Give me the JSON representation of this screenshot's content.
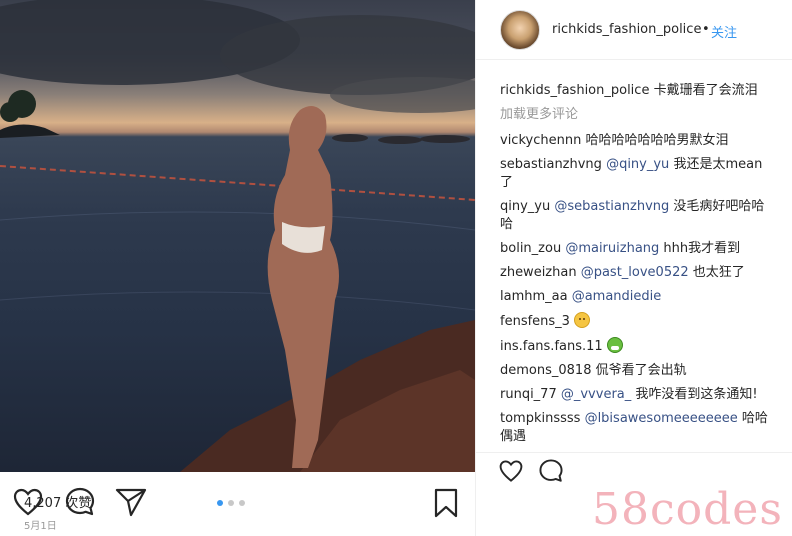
{
  "post": {
    "image_alt": "",
    "carousel": {
      "count": 3,
      "active": 0
    }
  },
  "header": {
    "username": "richkids_fashion_police",
    "separator": "•",
    "follow_label": "关注"
  },
  "caption": {
    "user": "richkids_fashion_police",
    "text": " 卡戴珊看了会流泪"
  },
  "load_more_label": "加载更多评论",
  "comments": [
    {
      "user": "vickychennn",
      "mention": "",
      "text": " 哈哈哈哈哈哈哈男默女泪"
    },
    {
      "user": "sebastianzhvng",
      "mention": " @qiny_yu",
      "text": " 我还是太mean了"
    },
    {
      "user": "qiny_yu",
      "mention": " @sebastianzhvng",
      "text": " 没毛病好吧哈哈哈"
    },
    {
      "user": "bolin_zou",
      "mention": " @mairuizhang",
      "text": " hhh我才看到"
    },
    {
      "user": "zheweizhan",
      "mention": " @past_love0522",
      "text": " 也太狂了"
    },
    {
      "user": "lamhm_aa",
      "mention": " @amandiedie",
      "text": ""
    },
    {
      "user": "fensfens_3",
      "mention": "",
      "text": " "
    },
    {
      "user": "ins.fans.fans.11",
      "mention": "",
      "text": " "
    },
    {
      "user": "demons_0818",
      "mention": "",
      "text": " 侃爷看了会出轨"
    },
    {
      "user": "runqi_77",
      "mention": " @_vvvera_",
      "text": " 我咋没看到这条通知!"
    },
    {
      "user": "tompkinssss",
      "mention": " @lbisawesomeeeeeeee",
      "text": " 哈哈偶遇"
    }
  ],
  "likes_label": "4,207 次赞",
  "date_label": "5月1日",
  "watermark": "58codes",
  "icons": {
    "like": "heart-icon",
    "comment": "comment-icon",
    "share": "share-icon",
    "save": "bookmark-icon"
  },
  "colors": {
    "link_blue": "#3897f0",
    "muted": "#999999",
    "text": "#262626",
    "watermark": "#f3b3bb"
  }
}
